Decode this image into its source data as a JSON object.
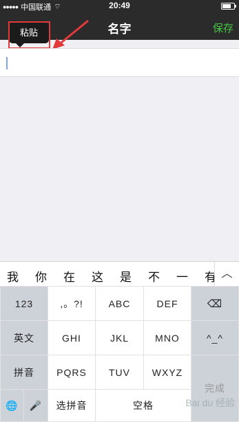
{
  "status_bar": {
    "carrier": "中国联通",
    "signal": "●●●●●",
    "wifi": "⌔",
    "time": "20:49"
  },
  "nav": {
    "title": "名字",
    "save": "保存",
    "back": "〈"
  },
  "paste_tooltip": "粘贴",
  "input": {
    "value": ""
  },
  "candidates": [
    "我",
    "你",
    "在",
    "这",
    "是",
    "不",
    "一",
    "有"
  ],
  "candidates_expand": "︿",
  "keyboard": {
    "row1": [
      "123",
      ",。?!",
      "ABC",
      "DEF",
      "⌫"
    ],
    "row2": [
      "英文",
      "GHI",
      "JKL",
      "MNO",
      "^_^"
    ],
    "row3": [
      "拼音",
      "PQRS",
      "TUV",
      "WXYZ",
      "完成"
    ],
    "row4": [
      "🌐",
      "🎤",
      "选拼音",
      "空格"
    ]
  },
  "watermark": "Bai du 经验",
  "colors": {
    "accent": "#46c846",
    "annotation": "#e23a3a"
  }
}
